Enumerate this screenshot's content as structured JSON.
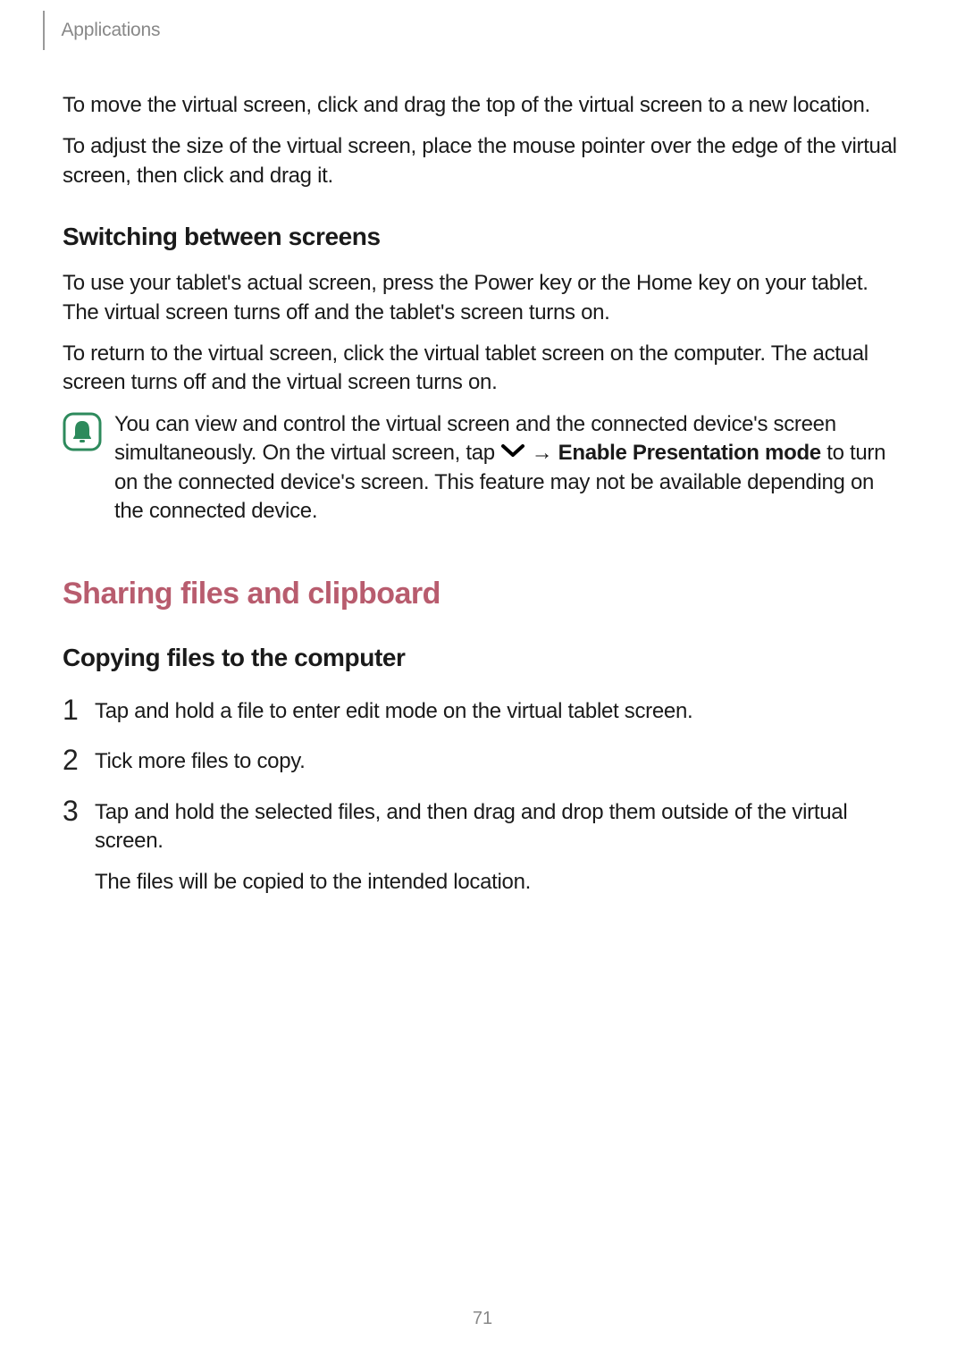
{
  "header": {
    "section": "Applications"
  },
  "body": {
    "p1": "To move the virtual screen, click and drag the top of the virtual screen to a new location.",
    "p2": "To adjust the size of the virtual screen, place the mouse pointer over the edge of the virtual screen, then click and drag it.",
    "h3a": "Switching between screens",
    "p3": "To use your tablet's actual screen, press the Power key or the Home key on your tablet. The virtual screen turns off and the tablet's screen turns on.",
    "p4": "To return to the virtual screen, click the virtual tablet screen on the computer. The actual screen turns off and the virtual screen turns on.",
    "note": {
      "pre": "You can view and control the virtual screen and the connected device's screen simultaneously. On the virtual screen, tap ",
      "arrow": " → ",
      "bold": "Enable Presentation mode",
      "post": " to turn on the connected device's screen. This feature may not be available depending on the connected device."
    },
    "h2": "Sharing files and clipboard",
    "h3b": "Copying files to the computer",
    "steps": [
      {
        "num": "1",
        "text": "Tap and hold a file to enter edit mode on the virtual tablet screen."
      },
      {
        "num": "2",
        "text": "Tick more files to copy."
      },
      {
        "num": "3",
        "text": "Tap and hold the selected files, and then drag and drop them outside of the virtual screen.",
        "followup": "The files will be copied to the intended location."
      }
    ]
  },
  "page_number": "71"
}
